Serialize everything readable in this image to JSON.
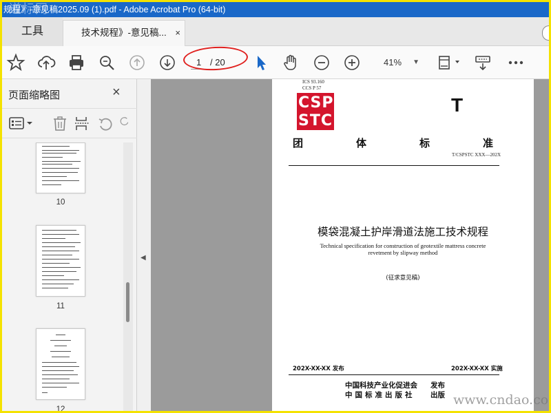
{
  "window": {
    "title": "规程》-意见稿2025.09 (1).pdf - Adobe Acrobat Pro (64-bit)",
    "watermark_top": "道标网",
    "watermark_bottom": "www.cndao.co"
  },
  "tabs": {
    "tools_label": "工具",
    "doc_tab_label": "技术规程》-意见稿...",
    "close_glyph": "×"
  },
  "toolbar": {
    "current_page": "1",
    "total_pages": "/ 20",
    "zoom": "41%",
    "icons": [
      "star-icon",
      "upload-cloud-icon",
      "print-icon",
      "zoom-search-icon",
      "page-up-icon",
      "page-down-icon",
      "select-cursor-icon",
      "hand-icon",
      "zoom-out-icon",
      "zoom-in-icon",
      "fit-page-icon",
      "keyboard-scroll-icon",
      "more-icon"
    ],
    "accent_color": "#1a68c8",
    "highlight_color": "#e0201e"
  },
  "sidebar": {
    "title": "页面缩略图",
    "close_glyph": "×",
    "thumbnails": [
      {
        "label": "10"
      },
      {
        "label": "11"
      },
      {
        "label": "12"
      }
    ]
  },
  "document": {
    "ics": "ICS   93.160",
    "ccs": "CCS   P 57",
    "logo_line1": "CSP",
    "logo_line2": "STC",
    "logo_color": "#d4152d",
    "big_letter": "T",
    "std_chars": [
      "团",
      "体",
      "标",
      "准"
    ],
    "code": "T/CSPSTC XXX—202X",
    "title_cn": "模袋混凝土护岸滑道法施工技术规程",
    "title_en_1": "Technical specification for construction of geotextile mattress concrete",
    "title_en_2": "revetment by slipway method",
    "draft": "(征求意见稿)",
    "publish_date": "202X-XX-XX  发布",
    "implement_date": "202X-XX-XX  实施",
    "org1": "中国科技产业化促进会",
    "org2": "中国标准出版社",
    "pub_word1": "发布",
    "pub_word2": "出版"
  }
}
